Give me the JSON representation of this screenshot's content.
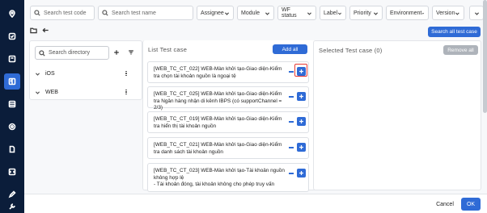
{
  "filters": {
    "search_code_placeholder": "Search test code",
    "search_name_placeholder": "Search test name",
    "dropdowns": [
      "Assignee",
      "Module",
      "WF status",
      "Label",
      "Priority",
      "Environment",
      "Version"
    ]
  },
  "actions": {
    "search_all": "Search all test case",
    "add_all": "Add all",
    "remove_all": "Remove all",
    "cancel": "Cancel",
    "ok": "OK"
  },
  "directory": {
    "search_placeholder": "Search directory",
    "items": [
      "iOS",
      "WEB"
    ]
  },
  "list": {
    "title": "List Test case",
    "cards": [
      "[WEB_TC_CT_022] WEB-Màn khởi tạo-Giao diện-Kiểm tra chọn tài khoản nguồn là ngoại tệ",
      "[WEB_TC_CT_025] WEB-Màn khởi tạo-Giao diện-Kiểm tra Ngân hàng nhận di kênh IBPS (có supportChannel = 2/3)",
      "[WEB_TC_CT_019] WEB-Màn khởi tạo-Giao diện-Kiểm tra hiển thị tài khoản nguồn",
      "[WEB_TC_CT_021] WEB-Màn khởi tạo-Giao diện-Kiểm tra danh sách tài khoản nguồn",
      "[WEB_TC_CT_023] WEB-Màn khởi tạo-Tài khoản nguồn không hợp lệ\n- Tài khoản đóng, tài khoản không cho phép truy vấn"
    ]
  },
  "selected": {
    "title": "Selected Test case (0)"
  },
  "colors": {
    "rail": "#0b1d3a",
    "primary": "#2f6bd6",
    "highlight": "#e53935"
  },
  "icons": [
    "location-icon",
    "check-circle-icon",
    "folder-icon",
    "book-icon",
    "table-icon",
    "settings-icon",
    "document-icon",
    "code-icon",
    "edit-icon",
    "tools-icon"
  ]
}
